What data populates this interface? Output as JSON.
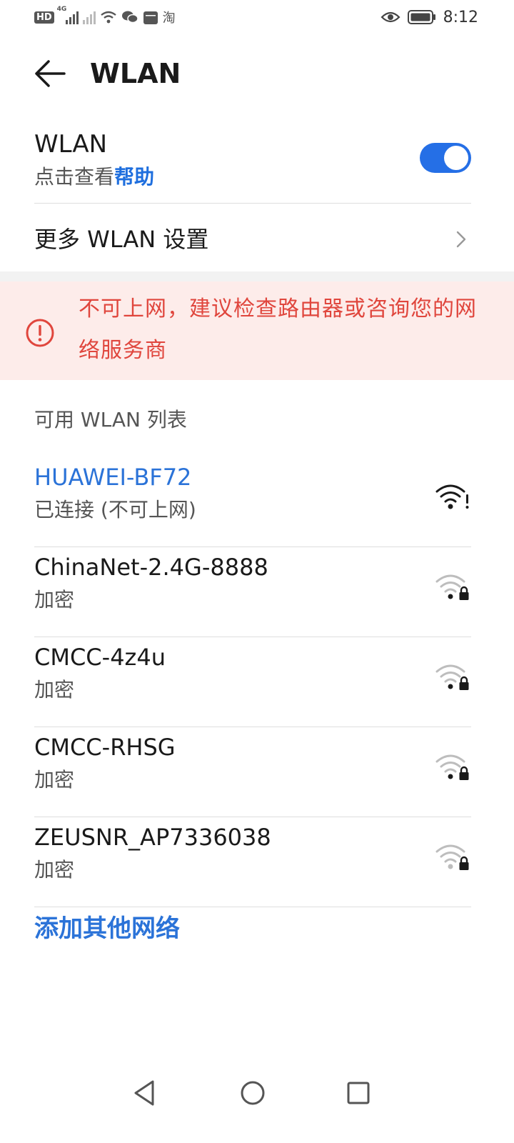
{
  "status_bar": {
    "hd_badge": "HD",
    "network_type": "4G",
    "time": "8:12",
    "taobao_glyph": "淘",
    "icons": [
      "hd-icon",
      "signal-4g-icon",
      "signal-nosim-icon",
      "wifi-status-icon",
      "wechat-icon",
      "calendar-icon",
      "taobao-icon",
      "eye-icon",
      "battery-icon"
    ]
  },
  "header": {
    "title": "WLAN",
    "back_icon": "back-arrow-icon"
  },
  "wlan_toggle": {
    "label": "WLAN",
    "subtitle_prefix": "点击查看",
    "subtitle_link": "帮助",
    "enabled": true,
    "accent_color": "#256fe6"
  },
  "more_settings": {
    "label": "更多 WLAN 设置"
  },
  "warning": {
    "text": "不可上网，建议检查路由器或咨询您的网络服务商",
    "color": "#e0463d",
    "icon": "alert-circle-icon"
  },
  "list_header": "可用 WLAN 列表",
  "networks": [
    {
      "name": "HUAWEI-BF72",
      "status": "已连接 (不可上网)",
      "connected": true,
      "icon": "wifi-alert-icon"
    },
    {
      "name": "ChinaNet-2.4G-8888",
      "status": "加密",
      "connected": false,
      "icon": "wifi-lock-icon",
      "signal_bars": 1
    },
    {
      "name": "CMCC-4z4u",
      "status": "加密",
      "connected": false,
      "icon": "wifi-lock-icon",
      "signal_bars": 1
    },
    {
      "name": "CMCC-RHSG",
      "status": "加密",
      "connected": false,
      "icon": "wifi-lock-icon",
      "signal_bars": 1
    },
    {
      "name": "ZEUSNR_AP7336038",
      "status": "加密",
      "connected": false,
      "icon": "wifi-lock-icon",
      "signal_bars": 0
    }
  ],
  "add_network": "添加其他网络",
  "nav_bar": {
    "buttons": [
      "back-triangle-icon",
      "home-circle-icon",
      "recents-square-icon"
    ]
  },
  "colors": {
    "link_blue": "#2b73d8",
    "warning_bg": "#fdecea"
  }
}
